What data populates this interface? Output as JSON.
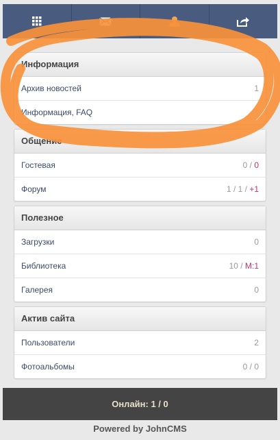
{
  "nav": {
    "tabs": [
      {
        "icon": "grid-icon"
      },
      {
        "icon": "mail-icon"
      },
      {
        "icon": "user-icon",
        "active": true
      },
      {
        "icon": "share-icon"
      }
    ],
    "active_color": "#f0a45a",
    "bg_color": "#4a5b80"
  },
  "sections": {
    "info": {
      "title": "Информация",
      "rows": [
        {
          "label": "Архив новостей",
          "count": "1"
        },
        {
          "label": "Информация, FAQ",
          "count": ""
        }
      ]
    },
    "communication": {
      "title": "Общение",
      "rows": [
        {
          "label": "Гостевая",
          "count_a": "0 / ",
          "count_b": "0"
        },
        {
          "label": "Форум",
          "count_a": "1 / 1 / ",
          "count_b": "+1"
        }
      ]
    },
    "useful": {
      "title": "Полезное",
      "rows": [
        {
          "label": "Загрузки",
          "count": "0"
        },
        {
          "label": "Библиотека",
          "count_a": "10 / ",
          "count_b": "М:1"
        },
        {
          "label": "Галерея",
          "count": "0"
        }
      ]
    },
    "activity": {
      "title": "Актив сайта",
      "rows": [
        {
          "label": "Пользователи",
          "count": "2"
        },
        {
          "label": "Фотоальбомы",
          "count": "0 / 0"
        }
      ]
    }
  },
  "footer": {
    "online": "Онлайн: 1 / 0",
    "powered": "Powered by JohnCMS"
  },
  "highlight_color": "#c0336d",
  "annotation_color": "#f7913a"
}
